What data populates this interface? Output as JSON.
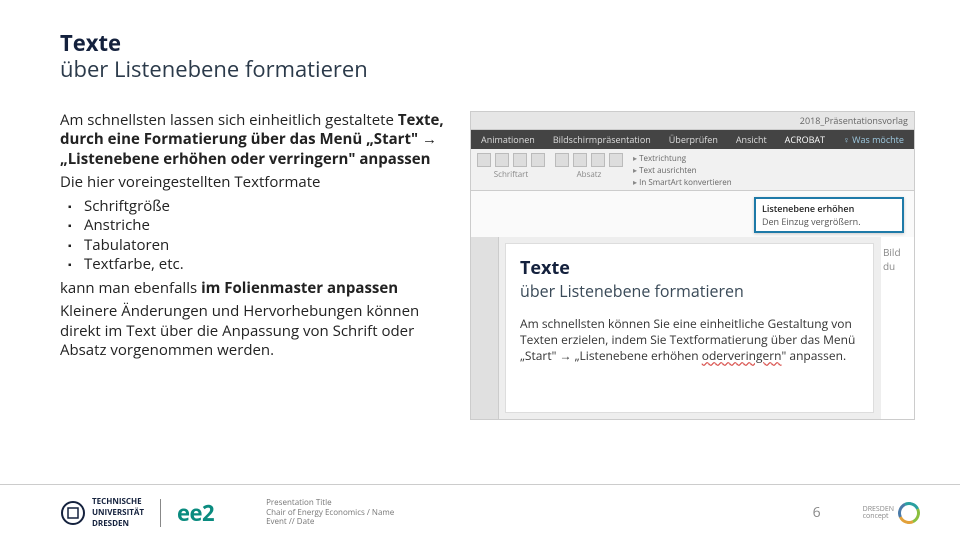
{
  "title": {
    "line1": "Texte",
    "line2": "über Listenebene formatieren"
  },
  "body": {
    "p1a": "Am schnellsten lassen sich einheitlich gestaltete",
    "p1b": "Texte, durch",
    "p1c": "eine Formatierung über das Menü „Start\" → „Listenebene erhöhen oder verringern\" anpassen",
    "p2": "Die hier voreingestellten Textformate",
    "bullets": [
      "Schriftgröße",
      "Anstriche",
      "Tabulatoren",
      "Textfarbe, etc."
    ],
    "p3a": "kann man ebenfalls ",
    "p3b": "im Folienmaster anpassen",
    "p4": "Kleinere Änderungen und Hervorhebungen können direkt im Text über die Anpassung von Schrift oder Absatz vorgenommen werden."
  },
  "mock": {
    "titlebar": "2018_Präsentationsvorlag",
    "tabs": [
      "Animationen",
      "Bildschirmpräsentation",
      "Überprüfen",
      "Ansicht",
      "ACROBAT"
    ],
    "tell_prefix": "♀",
    "tell": "Was möchte",
    "group_font": "Schriftart",
    "group_para": "Absatz",
    "extra1": "Textrichtung",
    "extra2": "Text ausrichten",
    "extra3": "In SmartArt konvertieren",
    "tooltip_title": "Listenebene erhöhen",
    "tooltip_body": "Den Einzug vergrößern.",
    "canvas_title1": "Texte",
    "canvas_title2": "über Listenebene formatieren",
    "canvas_body1": "Am schnellsten können Sie eine einheitliche Gestaltung von Texten erzielen, indem Sie Textformatierung über das Menü „Start\" → „Listenebene erhöhen ",
    "canvas_body_red": "oderveringern",
    "canvas_body2": "\" anpassen.",
    "sidecap": "Bild du"
  },
  "footer": {
    "tud1": "TECHNISCHE",
    "tud2": "UNIVERSITÄT",
    "tud3": "DRESDEN",
    "ee2": "ee2",
    "meta1": "Presentation Title",
    "meta2": "Chair of Energy Economics / Name",
    "meta3": "Event // Date",
    "page": "6",
    "dc1": "DRESDEN",
    "dc2": "concept"
  }
}
